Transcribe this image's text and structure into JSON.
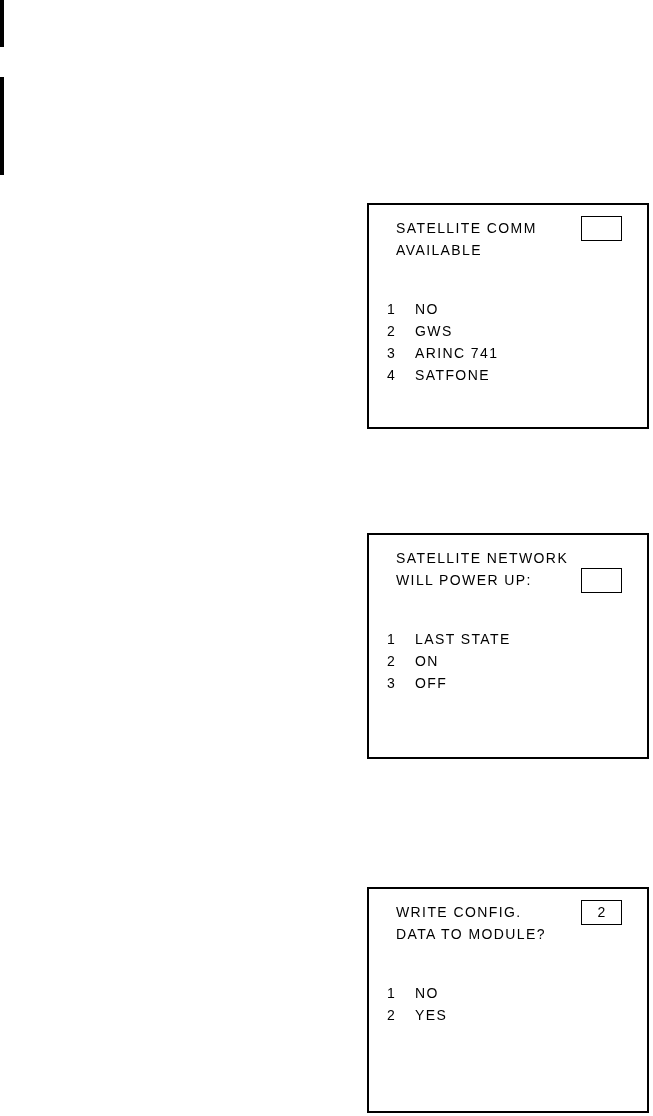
{
  "screens": [
    {
      "lines": [
        {
          "text": "SATELLITE COMM",
          "entry_box": true
        },
        {
          "text": "AVAILABLE",
          "entry_box": false
        }
      ],
      "options": [
        {
          "number": "1",
          "label": "NO"
        },
        {
          "number": "2",
          "label": "GWS"
        },
        {
          "number": "3",
          "label": "ARINC 741"
        },
        {
          "number": "4",
          "label": "SATFONE"
        }
      ]
    },
    {
      "lines": [
        {
          "text": "SATELLITE NETWORK",
          "entry_box": false
        },
        {
          "text": "WILL POWER UP:",
          "entry_box": true
        }
      ],
      "options": [
        {
          "number": "1",
          "label": "LAST STATE"
        },
        {
          "number": "2",
          "label": "ON"
        },
        {
          "number": "3",
          "label": "OFF"
        }
      ]
    },
    {
      "lines": [
        {
          "text": "WRITE CONFIG.",
          "entry_box": true,
          "entry_value": "2"
        },
        {
          "text": "DATA TO MODULE?",
          "entry_box": false
        }
      ],
      "options": [
        {
          "number": "1",
          "label": "NO"
        },
        {
          "number": "2",
          "label": "YES"
        }
      ]
    }
  ]
}
